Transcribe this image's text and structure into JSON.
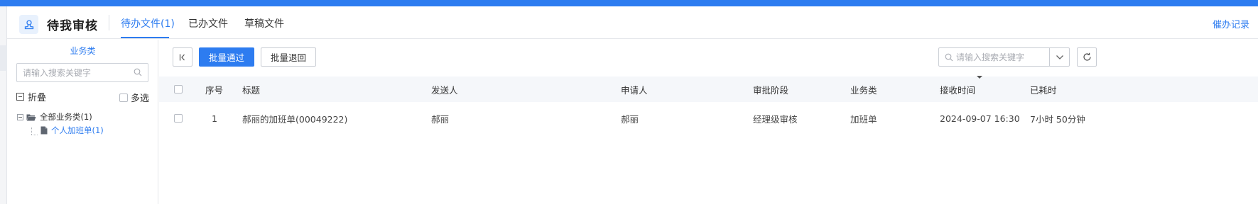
{
  "header": {
    "title": "待我审核",
    "tabs": [
      {
        "label": "待办文件(1)",
        "active": true
      },
      {
        "label": "已办文件",
        "active": false
      },
      {
        "label": "草稿文件",
        "active": false
      }
    ],
    "reminder_link": "催办记录"
  },
  "sidebar": {
    "title": "业务类",
    "search_placeholder": "请输入搜索关键字",
    "fold_label": "折叠",
    "multi_select_label": "多选",
    "tree": {
      "root": {
        "label": "全部业务类(1)"
      },
      "child": {
        "label": "个人加班单(1)"
      }
    }
  },
  "toolbar": {
    "approve_batch_label": "批量通过",
    "return_batch_label": "批量退回",
    "search_placeholder": "请输入搜索关键字"
  },
  "table": {
    "columns": [
      "序号",
      "标题",
      "发送人",
      "申请人",
      "审批阶段",
      "业务类",
      "接收时间",
      "已耗时"
    ],
    "rows": [
      {
        "index": "1",
        "title": "郝丽的加班单(00049222)",
        "sender": "郝丽",
        "applicant": "郝丽",
        "stage": "经理级审核",
        "category": "加班单",
        "received": "2024-09-07 16:30",
        "elapsed": "7小时 50分钟"
      }
    ]
  },
  "colors": {
    "accent": "#2d7cf0",
    "header_bg": "#f5f7fa"
  }
}
